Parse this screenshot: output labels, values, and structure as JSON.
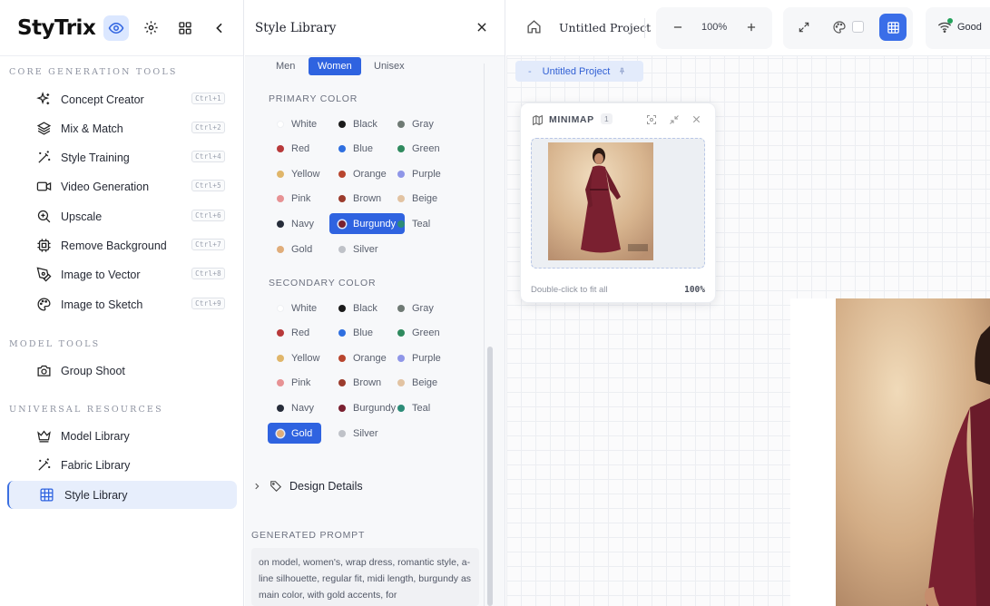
{
  "sidebar": {
    "logo": "StyTrix",
    "sections": [
      {
        "title": "CORE GENERATION TOOLS"
      },
      {
        "title": "MODEL TOOLS"
      },
      {
        "title": "UNIVERSAL RESOURCES"
      }
    ],
    "core_items": [
      {
        "label": "Concept Creator",
        "shortcut": "Ctrl+1",
        "icon": "sparkles-icon"
      },
      {
        "label": "Mix & Match",
        "shortcut": "Ctrl+2",
        "icon": "layers-icon"
      },
      {
        "label": "Style Training",
        "shortcut": "Ctrl+4",
        "icon": "magic-wand-icon"
      },
      {
        "label": "Video Generation",
        "shortcut": "Ctrl+5",
        "icon": "video-icon"
      },
      {
        "label": "Upscale",
        "shortcut": "Ctrl+6",
        "icon": "zoom-in-icon"
      },
      {
        "label": "Remove Background",
        "shortcut": "Ctrl+7",
        "icon": "chip-icon"
      },
      {
        "label": "Image to Vector",
        "shortcut": "Ctrl+8",
        "icon": "pen-tool-icon"
      },
      {
        "label": "Image to Sketch",
        "shortcut": "Ctrl+9",
        "icon": "palette-icon"
      }
    ],
    "model_items": [
      {
        "label": "Group Shoot",
        "icon": "camera-icon"
      }
    ],
    "resource_items": [
      {
        "label": "Model Library",
        "icon": "crown-icon"
      },
      {
        "label": "Fabric Library",
        "icon": "magic-wand-icon"
      },
      {
        "label": "Style Library",
        "icon": "grid-icon",
        "active": true
      }
    ]
  },
  "panel": {
    "title": "Style Library",
    "gender": [
      {
        "label": "Men"
      },
      {
        "label": "Women",
        "selected": true
      },
      {
        "label": "Unisex"
      }
    ],
    "primary_label": "PRIMARY COLOR",
    "secondary_label": "SECONDARY COLOR",
    "colors": [
      {
        "label": "White",
        "color": "#ffffff"
      },
      {
        "label": "Black",
        "color": "#1a1a1a"
      },
      {
        "label": "Gray",
        "color": "#6f7a74"
      },
      {
        "label": "Red",
        "color": "#b8393a"
      },
      {
        "label": "Blue",
        "color": "#2f6fe0"
      },
      {
        "label": "Green",
        "color": "#2f8a5e"
      },
      {
        "label": "Yellow",
        "color": "#e0b66a"
      },
      {
        "label": "Orange",
        "color": "#b8452e"
      },
      {
        "label": "Purple",
        "color": "#8f96e8"
      },
      {
        "label": "Pink",
        "color": "#e79294"
      },
      {
        "label": "Brown",
        "color": "#9b3b2c"
      },
      {
        "label": "Beige",
        "color": "#e2c3a2"
      },
      {
        "label": "Navy",
        "color": "#272d3a"
      },
      {
        "label": "Burgundy",
        "color": "#7a2030"
      },
      {
        "label": "Teal",
        "color": "#2c8c78"
      },
      {
        "label": "Gold",
        "color": "#e0ad7a"
      },
      {
        "label": "Silver",
        "color": "#bfc2c8"
      }
    ],
    "primary_selected": "Burgundy",
    "secondary_selected": "Gold",
    "design_details": "Design Details",
    "generated_prompt_label": "GENERATED PROMPT",
    "generated_prompt": "on model, women's, wrap dress, romantic style, a-line silhouette, regular fit, midi length, burgundy as main color, with gold accents, for"
  },
  "canvas": {
    "project_title": "Untitled Project",
    "zoom": "100%",
    "status": "Good",
    "tab_label": "Untitled Project",
    "minimap": {
      "title": "MINIMAP",
      "count": "1",
      "footer": "Double-click to fit all",
      "zoom": "100%"
    }
  }
}
